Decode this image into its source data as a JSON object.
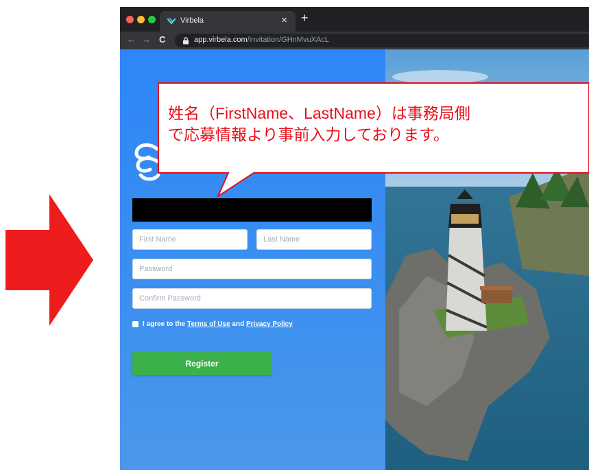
{
  "browser": {
    "tab_title": "Virbela",
    "tab_close": "×",
    "new_tab": "+",
    "nav_back": "←",
    "nav_forward": "→",
    "nav_reload": "C",
    "url_host": "app.virbela.com",
    "url_path": "/invitation/GHnMvuXAcL"
  },
  "form": {
    "first_name_placeholder": "First Name",
    "last_name_placeholder": "Last Name",
    "password_placeholder": "Password",
    "confirm_password_placeholder": "Confirm Password",
    "agree_prefix": "I agree to the ",
    "terms_link": "Terms of Use",
    "agree_and": " and ",
    "privacy_link": "Privacy Policy",
    "register_label": "Register"
  },
  "callout": {
    "line1": "姓名（FirstName、LastName）は事務局側",
    "line2": "で応募情報より事前入力しております。"
  },
  "colors": {
    "arrow": "#ee1c1c",
    "panel_blue": "#2e86f8",
    "register_green": "#3cb04b",
    "callout_red": "#e8101a"
  }
}
